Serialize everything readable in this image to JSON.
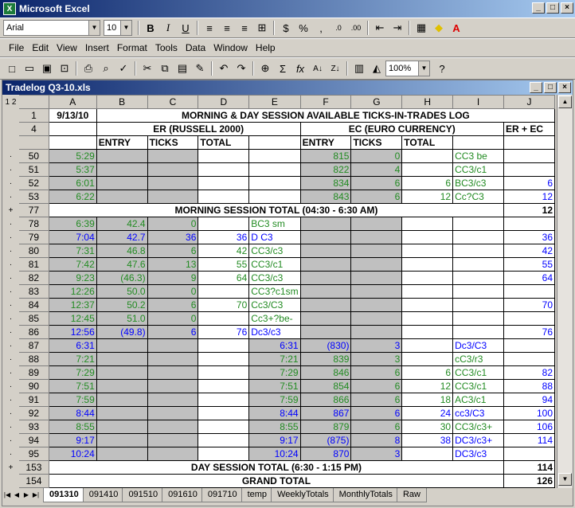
{
  "app": {
    "title": "Microsoft Excel",
    "doc_title": "Tradelog Q3-10.xls"
  },
  "format": {
    "font": "Arial",
    "size": "10"
  },
  "menu": [
    "File",
    "Edit",
    "View",
    "Insert",
    "Format",
    "Tools",
    "Data",
    "Window",
    "Help"
  ],
  "zoom": "100%",
  "columns": [
    "A",
    "B",
    "C",
    "D",
    "E",
    "F",
    "G",
    "H",
    "I",
    "J"
  ],
  "rows": [
    {
      "n": "1",
      "ol": "",
      "cells": [
        {
          "t": "9/13/10",
          "cls": "c b"
        },
        {
          "t": "MORNING & DAY SESSION AVAILABLE TICKS-IN-TRADES LOG",
          "span": 9,
          "cls": "c b"
        }
      ]
    },
    {
      "n": "4",
      "ol": "",
      "cells": [
        {
          "t": ""
        },
        {
          "t": "ER (RUSSELL 2000)",
          "span": 4,
          "cls": "c b"
        },
        {
          "t": "EC (EURO CURRENCY)",
          "span": 4,
          "cls": "c b"
        },
        {
          "t": "ER + EC",
          "cls": "b"
        }
      ]
    },
    {
      "n": "",
      "ol": "",
      "cells": [
        {
          "t": ""
        },
        {
          "t": "ENTRY",
          "cls": "b"
        },
        {
          "t": "TICKS",
          "cls": "b"
        },
        {
          "t": "TOTAL",
          "cls": "b"
        },
        {
          "t": ""
        },
        {
          "t": "ENTRY",
          "cls": "b"
        },
        {
          "t": "TICKS",
          "cls": "b"
        },
        {
          "t": "TOTAL",
          "cls": "b"
        },
        {
          "t": ""
        },
        {
          "t": ""
        }
      ]
    },
    {
      "n": "50",
      "ol": "·",
      "cells": [
        {
          "t": "5:29",
          "cls": "r g grn"
        },
        {
          "t": "",
          "cls": "g"
        },
        {
          "t": "",
          "cls": "g"
        },
        {
          "t": ""
        },
        {
          "t": ""
        },
        {
          "t": "815",
          "cls": "r g grn"
        },
        {
          "t": "0",
          "cls": "r g grn"
        },
        {
          "t": ""
        },
        {
          "t": "CC3 be",
          "cls": "grn"
        },
        {
          "t": ""
        }
      ]
    },
    {
      "n": "51",
      "ol": "·",
      "cells": [
        {
          "t": "5:37",
          "cls": "r g grn"
        },
        {
          "t": "",
          "cls": "g"
        },
        {
          "t": "",
          "cls": "g"
        },
        {
          "t": ""
        },
        {
          "t": ""
        },
        {
          "t": "822",
          "cls": "r g grn"
        },
        {
          "t": "4",
          "cls": "r g grn"
        },
        {
          "t": ""
        },
        {
          "t": "CC3/c1",
          "cls": "grn"
        },
        {
          "t": ""
        }
      ]
    },
    {
      "n": "52",
      "ol": "·",
      "cells": [
        {
          "t": "6:01",
          "cls": "r g grn"
        },
        {
          "t": "",
          "cls": "g"
        },
        {
          "t": "",
          "cls": "g"
        },
        {
          "t": ""
        },
        {
          "t": ""
        },
        {
          "t": "834",
          "cls": "r g grn"
        },
        {
          "t": "6",
          "cls": "r g grn"
        },
        {
          "t": "6",
          "cls": "r grn"
        },
        {
          "t": "BC3/c3",
          "cls": "grn"
        },
        {
          "t": "6",
          "cls": "r blu"
        }
      ]
    },
    {
      "n": "53",
      "ol": "·",
      "cells": [
        {
          "t": "6:22",
          "cls": "r g grn"
        },
        {
          "t": "",
          "cls": "g"
        },
        {
          "t": "",
          "cls": "g"
        },
        {
          "t": ""
        },
        {
          "t": ""
        },
        {
          "t": "843",
          "cls": "r g grn"
        },
        {
          "t": "6",
          "cls": "r g grn"
        },
        {
          "t": "12",
          "cls": "r grn"
        },
        {
          "t": "Cc?C3",
          "cls": "grn"
        },
        {
          "t": "12",
          "cls": "r blu"
        }
      ]
    },
    {
      "n": "77",
      "ol": "+",
      "cells": [
        {
          "t": "MORNING SESSION TOTAL (04:30 - 6:30 AM)",
          "span": 9,
          "cls": "c b"
        },
        {
          "t": "12",
          "cls": "r b"
        }
      ]
    },
    {
      "n": "78",
      "ol": "·",
      "cells": [
        {
          "t": "6:39",
          "cls": "r g grn"
        },
        {
          "t": "42.4",
          "cls": "r g grn"
        },
        {
          "t": "0",
          "cls": "r g grn"
        },
        {
          "t": ""
        },
        {
          "t": "BC3 sm",
          "cls": "grn"
        },
        {
          "t": "",
          "cls": "g"
        },
        {
          "t": "",
          "cls": "g"
        },
        {
          "t": ""
        },
        {
          "t": ""
        },
        {
          "t": ""
        }
      ]
    },
    {
      "n": "79",
      "ol": "·",
      "cells": [
        {
          "t": "7:04",
          "cls": "r g blu"
        },
        {
          "t": "42.7",
          "cls": "r g blu"
        },
        {
          "t": "36",
          "cls": "r g blu"
        },
        {
          "t": "36",
          "cls": "r blu"
        },
        {
          "t": "D C3",
          "cls": "blu"
        },
        {
          "t": "",
          "cls": "g"
        },
        {
          "t": "",
          "cls": "g"
        },
        {
          "t": ""
        },
        {
          "t": ""
        },
        {
          "t": "36",
          "cls": "r blu"
        }
      ]
    },
    {
      "n": "80",
      "ol": "·",
      "cells": [
        {
          "t": "7:31",
          "cls": "r g grn"
        },
        {
          "t": "46.8",
          "cls": "r g grn"
        },
        {
          "t": "6",
          "cls": "r g grn"
        },
        {
          "t": "42",
          "cls": "r grn"
        },
        {
          "t": "CC3/c3",
          "cls": "grn"
        },
        {
          "t": "",
          "cls": "g"
        },
        {
          "t": "",
          "cls": "g"
        },
        {
          "t": ""
        },
        {
          "t": ""
        },
        {
          "t": "42",
          "cls": "r blu"
        }
      ]
    },
    {
      "n": "81",
      "ol": "·",
      "cells": [
        {
          "t": "7:42",
          "cls": "r g grn"
        },
        {
          "t": "47.6",
          "cls": "r g grn"
        },
        {
          "t": "13",
          "cls": "r g grn"
        },
        {
          "t": "55",
          "cls": "r grn"
        },
        {
          "t": "CC3/c1",
          "cls": "grn"
        },
        {
          "t": "",
          "cls": "g"
        },
        {
          "t": "",
          "cls": "g"
        },
        {
          "t": ""
        },
        {
          "t": ""
        },
        {
          "t": "55",
          "cls": "r blu"
        }
      ]
    },
    {
      "n": "82",
      "ol": "·",
      "cells": [
        {
          "t": "9:23",
          "cls": "r g grn"
        },
        {
          "t": "(46.3)",
          "cls": "r g grn"
        },
        {
          "t": "9",
          "cls": "r g grn"
        },
        {
          "t": "64",
          "cls": "r grn"
        },
        {
          "t": "CC3/c3",
          "cls": "grn"
        },
        {
          "t": "",
          "cls": "g"
        },
        {
          "t": "",
          "cls": "g"
        },
        {
          "t": ""
        },
        {
          "t": ""
        },
        {
          "t": "64",
          "cls": "r blu"
        }
      ]
    },
    {
      "n": "83",
      "ol": "·",
      "cells": [
        {
          "t": "12:26",
          "cls": "r g grn"
        },
        {
          "t": "50.0",
          "cls": "r g grn"
        },
        {
          "t": "0",
          "cls": "r g grn"
        },
        {
          "t": ""
        },
        {
          "t": "CC3?c1sm",
          "cls": "grn"
        },
        {
          "t": "",
          "cls": "g"
        },
        {
          "t": "",
          "cls": "g"
        },
        {
          "t": ""
        },
        {
          "t": ""
        },
        {
          "t": ""
        }
      ]
    },
    {
      "n": "84",
      "ol": "·",
      "cells": [
        {
          "t": "12:37",
          "cls": "r g grn"
        },
        {
          "t": "50.2",
          "cls": "r g grn"
        },
        {
          "t": "6",
          "cls": "r g grn"
        },
        {
          "t": "70",
          "cls": "r grn"
        },
        {
          "t": "Cc3/C3",
          "cls": "grn"
        },
        {
          "t": "",
          "cls": "g"
        },
        {
          "t": "",
          "cls": "g"
        },
        {
          "t": ""
        },
        {
          "t": ""
        },
        {
          "t": "70",
          "cls": "r blu"
        }
      ]
    },
    {
      "n": "85",
      "ol": "·",
      "cells": [
        {
          "t": "12:45",
          "cls": "r g grn"
        },
        {
          "t": "51.0",
          "cls": "r g grn"
        },
        {
          "t": "0",
          "cls": "r g grn"
        },
        {
          "t": ""
        },
        {
          "t": "Cc3+?be-",
          "cls": "grn"
        },
        {
          "t": "",
          "cls": "g"
        },
        {
          "t": "",
          "cls": "g"
        },
        {
          "t": ""
        },
        {
          "t": ""
        },
        {
          "t": ""
        }
      ]
    },
    {
      "n": "86",
      "ol": "·",
      "cells": [
        {
          "t": "12:56",
          "cls": "r g blu"
        },
        {
          "t": "(49.8)",
          "cls": "r g blu"
        },
        {
          "t": "6",
          "cls": "r g blu"
        },
        {
          "t": "76",
          "cls": "r blu"
        },
        {
          "t": "Dc3/c3",
          "cls": "blu"
        },
        {
          "t": "",
          "cls": "g"
        },
        {
          "t": "",
          "cls": "g"
        },
        {
          "t": ""
        },
        {
          "t": ""
        },
        {
          "t": "76",
          "cls": "r blu"
        }
      ]
    },
    {
      "n": "87",
      "ol": "·",
      "cells": [
        {
          "t": "6:31",
          "cls": "r g blu"
        },
        {
          "t": "",
          "cls": "g"
        },
        {
          "t": "",
          "cls": "g"
        },
        {
          "t": ""
        },
        {
          "t": "6:31",
          "cls": "r g blu"
        },
        {
          "t": "(830)",
          "cls": "r g blu"
        },
        {
          "t": "3",
          "cls": "r g blu"
        },
        {
          "t": ""
        },
        {
          "t": "Dc3/C3",
          "cls": "blu"
        },
        {
          "t": ""
        }
      ]
    },
    {
      "n": "88",
      "ol": "·",
      "cells": [
        {
          "t": "7:21",
          "cls": "r g grn"
        },
        {
          "t": "",
          "cls": "g"
        },
        {
          "t": "",
          "cls": "g"
        },
        {
          "t": ""
        },
        {
          "t": "7:21",
          "cls": "r g grn"
        },
        {
          "t": "839",
          "cls": "r g grn"
        },
        {
          "t": "3",
          "cls": "r g grn"
        },
        {
          "t": ""
        },
        {
          "t": "cC3/r3",
          "cls": "grn"
        },
        {
          "t": ""
        }
      ]
    },
    {
      "n": "89",
      "ol": "·",
      "cells": [
        {
          "t": "7:29",
          "cls": "r g grn"
        },
        {
          "t": "",
          "cls": "g"
        },
        {
          "t": "",
          "cls": "g"
        },
        {
          "t": ""
        },
        {
          "t": "7:29",
          "cls": "r g grn"
        },
        {
          "t": "846",
          "cls": "r g grn"
        },
        {
          "t": "6",
          "cls": "r g grn"
        },
        {
          "t": "6",
          "cls": "r grn"
        },
        {
          "t": "CC3/c1",
          "cls": "grn"
        },
        {
          "t": "82",
          "cls": "r blu"
        }
      ]
    },
    {
      "n": "90",
      "ol": "·",
      "cells": [
        {
          "t": "7:51",
          "cls": "r g grn"
        },
        {
          "t": "",
          "cls": "g"
        },
        {
          "t": "",
          "cls": "g"
        },
        {
          "t": ""
        },
        {
          "t": "7:51",
          "cls": "r g grn"
        },
        {
          "t": "854",
          "cls": "r g grn"
        },
        {
          "t": "6",
          "cls": "r g grn"
        },
        {
          "t": "12",
          "cls": "r grn"
        },
        {
          "t": "CC3/c1",
          "cls": "grn"
        },
        {
          "t": "88",
          "cls": "r blu"
        }
      ]
    },
    {
      "n": "91",
      "ol": "·",
      "cells": [
        {
          "t": "7:59",
          "cls": "r g grn"
        },
        {
          "t": "",
          "cls": "g"
        },
        {
          "t": "",
          "cls": "g"
        },
        {
          "t": ""
        },
        {
          "t": "7:59",
          "cls": "r g grn"
        },
        {
          "t": "866",
          "cls": "r g grn"
        },
        {
          "t": "6",
          "cls": "r g grn"
        },
        {
          "t": "18",
          "cls": "r grn"
        },
        {
          "t": "AC3/c1",
          "cls": "grn"
        },
        {
          "t": "94",
          "cls": "r blu"
        }
      ]
    },
    {
      "n": "92",
      "ol": "·",
      "cells": [
        {
          "t": "8:44",
          "cls": "r g blu"
        },
        {
          "t": "",
          "cls": "g"
        },
        {
          "t": "",
          "cls": "g"
        },
        {
          "t": ""
        },
        {
          "t": "8:44",
          "cls": "r g blu"
        },
        {
          "t": "867",
          "cls": "r g blu"
        },
        {
          "t": "6",
          "cls": "r g blu"
        },
        {
          "t": "24",
          "cls": "r blu"
        },
        {
          "t": "cc3/C3",
          "cls": "blu"
        },
        {
          "t": "100",
          "cls": "r blu"
        }
      ]
    },
    {
      "n": "93",
      "ol": "·",
      "cells": [
        {
          "t": "8:55",
          "cls": "r g grn"
        },
        {
          "t": "",
          "cls": "g"
        },
        {
          "t": "",
          "cls": "g"
        },
        {
          "t": ""
        },
        {
          "t": "8:55",
          "cls": "r g grn"
        },
        {
          "t": "879",
          "cls": "r g grn"
        },
        {
          "t": "6",
          "cls": "r g grn"
        },
        {
          "t": "30",
          "cls": "r grn"
        },
        {
          "t": "CC3/c3+",
          "cls": "grn"
        },
        {
          "t": "106",
          "cls": "r blu"
        }
      ]
    },
    {
      "n": "94",
      "ol": "·",
      "cells": [
        {
          "t": "9:17",
          "cls": "r g blu"
        },
        {
          "t": "",
          "cls": "g"
        },
        {
          "t": "",
          "cls": "g"
        },
        {
          "t": ""
        },
        {
          "t": "9:17",
          "cls": "r g blu"
        },
        {
          "t": "(875)",
          "cls": "r g blu"
        },
        {
          "t": "8",
          "cls": "r g blu"
        },
        {
          "t": "38",
          "cls": "r blu"
        },
        {
          "t": "DC3/c3+",
          "cls": "blu"
        },
        {
          "t": "114",
          "cls": "r blu"
        }
      ]
    },
    {
      "n": "95",
      "ol": "·",
      "cells": [
        {
          "t": "10:24",
          "cls": "r g blu"
        },
        {
          "t": "",
          "cls": "g"
        },
        {
          "t": "",
          "cls": "g"
        },
        {
          "t": ""
        },
        {
          "t": "10:24",
          "cls": "r g blu"
        },
        {
          "t": "870",
          "cls": "r g blu"
        },
        {
          "t": "3",
          "cls": "r g blu"
        },
        {
          "t": ""
        },
        {
          "t": "DC3/c3",
          "cls": "blu"
        },
        {
          "t": ""
        }
      ]
    },
    {
      "n": "153",
      "ol": "+",
      "cells": [
        {
          "t": "DAY SESSION TOTAL (6:30 - 1:15 PM)",
          "span": 9,
          "cls": "c b"
        },
        {
          "t": "114",
          "cls": "r b"
        }
      ]
    },
    {
      "n": "154",
      "ol": "",
      "cells": [
        {
          "t": "GRAND TOTAL",
          "span": 9,
          "cls": "c b"
        },
        {
          "t": "126",
          "cls": "r b"
        }
      ]
    }
  ],
  "sheets": [
    "091310",
    "091410",
    "091510",
    "091610",
    "091710",
    "temp",
    "WeeklyTotals",
    "MonthlyTotals",
    "Raw"
  ],
  "active_sheet": "091310",
  "outline_levels": [
    "1",
    "2"
  ],
  "colors": {
    "green": "#228b22",
    "blue": "#0000ff",
    "shade": "#c0c0c0"
  }
}
